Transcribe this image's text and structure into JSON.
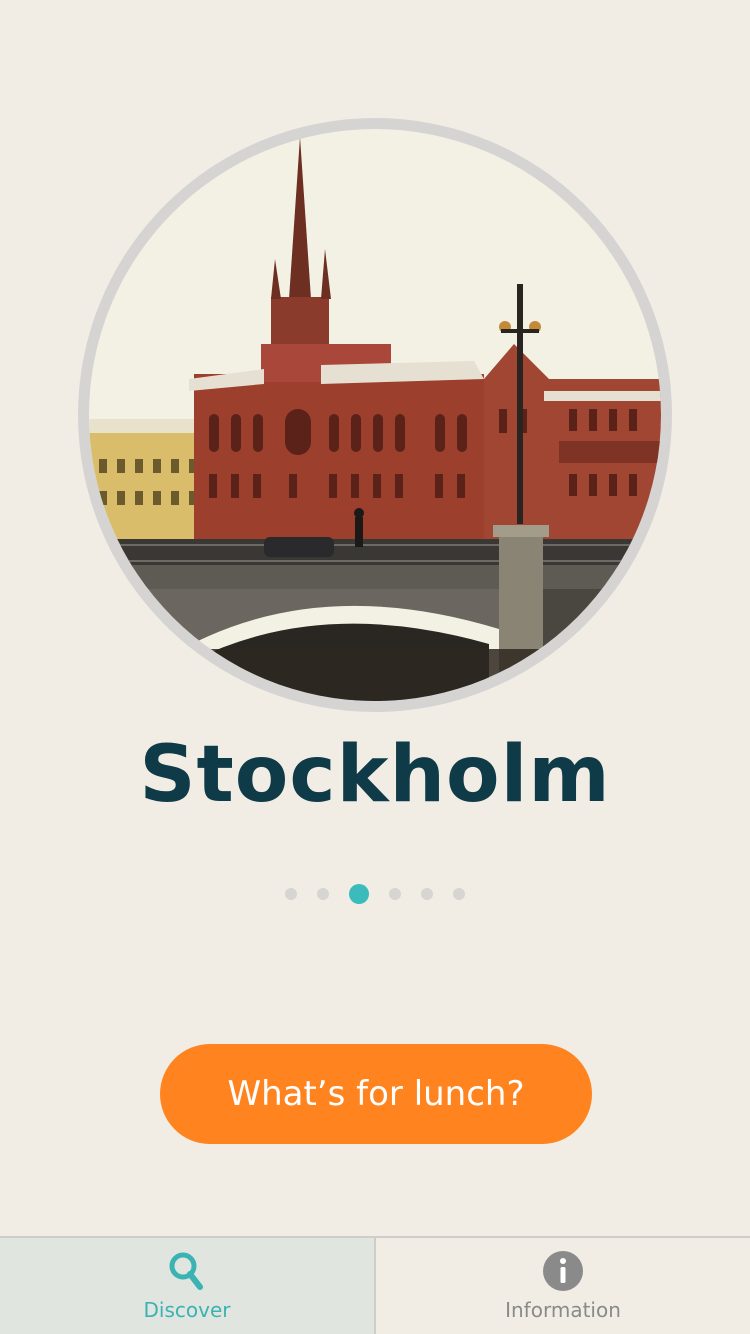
{
  "city": {
    "name": "Stockholm",
    "image": "stockholm-photo"
  },
  "pager": {
    "count": 6,
    "active_index": 2
  },
  "cta": {
    "label": "What’s for lunch?"
  },
  "tabbar": {
    "tabs": [
      {
        "label": "Discover",
        "icon": "search-icon",
        "selected": true
      },
      {
        "label": "Information",
        "icon": "info-icon",
        "selected": false
      }
    ]
  },
  "colors": {
    "background": "#f1ede5",
    "title": "#0f3a47",
    "accent": "#3bbcbb",
    "cta": "#ff8420"
  }
}
